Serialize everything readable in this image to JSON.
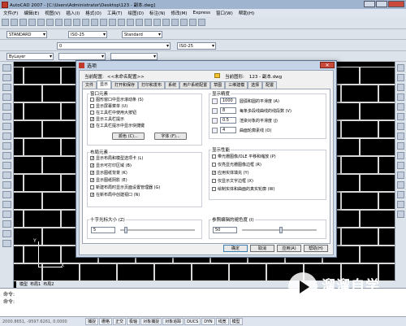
{
  "window": {
    "title": "AutoCAD 2007 - [C:\\Users\\Administrator\\Desktop\\123 - 副本.dwg]"
  },
  "menu": [
    "文件(F)",
    "编辑(E)",
    "视图(V)",
    "插入(I)",
    "格式(O)",
    "工具(T)",
    "绘图(D)",
    "标注(N)",
    "修改(M)",
    "Express",
    "窗口(W)",
    "帮助(H)"
  ],
  "toolbar": {
    "text_style": "STANDARD",
    "dim_style": "ISO-25",
    "table_style": "Standard",
    "layer": "0",
    "color": "ByLayer",
    "dim_style2": "ISO-25"
  },
  "dialog": {
    "title": "选项",
    "close": "✕",
    "current_profile_label": "当前配置:",
    "current_profile_value": "<<未命名配置>>",
    "current_drawing_label": "当前图形:",
    "current_drawing_value": "123 - 副本.dwg",
    "tabs": [
      "文件",
      "显示",
      "打开和保存",
      "打印和发布",
      "系统",
      "用户系统配置",
      "草图",
      "三维建模",
      "选择",
      "配置"
    ],
    "active_tab": 1,
    "window_elements": {
      "label": "窗口元素",
      "items": [
        {
          "label": "图形窗口中显示滚动条 (S)",
          "checked": false
        },
        {
          "label": "显示屏幕菜单 (U)",
          "checked": false
        },
        {
          "label": "在工具栏中使用大按钮",
          "checked": false
        },
        {
          "label": "显示工具栏提示",
          "checked": true
        },
        {
          "label": "在工具栏提示中显示快捷键",
          "checked": true
        }
      ],
      "colors_button": "颜色 (C)...",
      "fonts_button": "字体 (F)..."
    },
    "layout_elements": {
      "label": "布局元素",
      "items": [
        {
          "label": "显示布局和模型选项卡 (L)",
          "checked": true
        },
        {
          "label": "显示可打印区域 (B)",
          "checked": true
        },
        {
          "label": "显示图纸背景 (K)",
          "checked": true
        },
        {
          "label": "显示图纸阴影 (E)",
          "checked": true
        },
        {
          "label": "新建布局时显示页面设置管理器 (G)",
          "checked": false
        },
        {
          "label": "在新布局中创建视口 (N)",
          "checked": true
        }
      ]
    },
    "display_resolution": {
      "label": "显示精度",
      "items": [
        {
          "value": "1000",
          "label": "圆弧和圆的平滑度 (A)"
        },
        {
          "value": "8",
          "label": "每条多段线曲线的线段数 (V)"
        },
        {
          "value": "0.5",
          "label": "渲染对象的平滑度 (J)"
        },
        {
          "value": "4",
          "label": "曲面轮廓素线 (O)"
        }
      ]
    },
    "display_performance": {
      "label": "显示性能",
      "items": [
        {
          "label": "带光栅图像/OLE 平移和缩放 (P)",
          "checked": false
        },
        {
          "label": "仅亮显光栅图像边框 (R)",
          "checked": false
        },
        {
          "label": "应用实体填充 (Y)",
          "checked": true
        },
        {
          "label": "仅显示文字边框 (X)",
          "checked": false
        },
        {
          "label": "绘制实体和曲面的真实轮廓 (W)",
          "checked": false
        }
      ]
    },
    "crosshair": {
      "label": "十字光标大小 (Z)",
      "value": "5",
      "fraction": 0.05
    },
    "fade": {
      "label": "参照编辑的褪色度 (I)",
      "value": "50",
      "fraction": 0.5
    },
    "buttons": {
      "ok": "确定",
      "cancel": "取消",
      "apply": "应用(A)",
      "help": "帮助(H)"
    }
  },
  "layout_tabs": [
    "模型",
    "布局1",
    "布局2"
  ],
  "command_line": {
    "line1": "命令:",
    "line2": "命令:"
  },
  "status": {
    "coords": "2000.8651, -9597.6261, 0.0000",
    "buttons": [
      "捕捉",
      "栅格",
      "正交",
      "极轴",
      "对象捕捉",
      "对象追踪",
      "DUCS",
      "DYN",
      "线宽",
      "模型"
    ]
  },
  "watermark": {
    "title": "溜溜自学",
    "url": "ZIXUE.3066.COM"
  }
}
